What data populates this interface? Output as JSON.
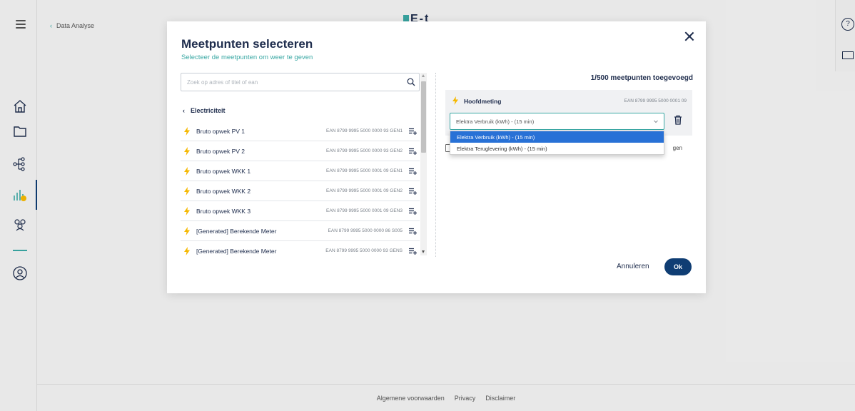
{
  "app": {
    "logo_text": "E-t",
    "breadcrumb": {
      "back_label": "Data Analyse"
    },
    "footer": {
      "links": [
        "Algemene voorwaarden",
        "Privacy",
        "Disclaimer"
      ]
    },
    "sidebar_icons": [
      "home-icon",
      "folder-icon",
      "hierarchy-icon",
      "chart-icon",
      "users-icon",
      "account-icon"
    ]
  },
  "modal": {
    "title": "Meetpunten selecteren",
    "subtitle": "Selecteer de meetpunten om weer te geven",
    "search": {
      "placeholder": "Zoek op adres of titel of ean",
      "value": ""
    },
    "category_label": "Electriciteit",
    "meetpunten": [
      {
        "name": "Bruto opwek PV 1",
        "ean": "EAN 8799 9995 5000 0000 93 GEN1"
      },
      {
        "name": "Bruto opwek PV 2",
        "ean": "EAN 8799 9995 5000 0000 93 GEN2"
      },
      {
        "name": "Bruto opwek WKK 1",
        "ean": "EAN 8799 9995 5000 0001 09 GEN1"
      },
      {
        "name": "Bruto opwek WKK 2",
        "ean": "EAN 8799 9995 5000 0001 09 GEN2"
      },
      {
        "name": "Bruto opwek WKK 3",
        "ean": "EAN 8799 9995 5000 0001 09 GEN3"
      },
      {
        "name": "[Generated] Berekende Meter",
        "ean": "EAN 8799 9995 5000 0000 86 S005"
      },
      {
        "name": "[Generated] Berekende Meter",
        "ean": "EAN 8799 9995 5000 0000 93 GENS"
      }
    ],
    "added_count": "1/500 meetpunten toegevoegd",
    "selected": {
      "title": "Hoofdmeting",
      "ean": "EAN 8799 9995 5000 0001 09",
      "select_value": "Elektra Verbruik (kWh) - (15 min)",
      "options": [
        "Elektra Verbruik (kWh) - (15 min)",
        "Elektra Teruglevering (kWh) - (15 min)"
      ],
      "checkbox_label_fragment": "gen"
    },
    "cancel_label": "Annuleren",
    "ok_label": "Ok"
  },
  "colors": {
    "accent": "#3aa8a4",
    "primary": "#0f3d73",
    "bolt": "#f5b800",
    "dropdown_selected": "#2871d6"
  }
}
